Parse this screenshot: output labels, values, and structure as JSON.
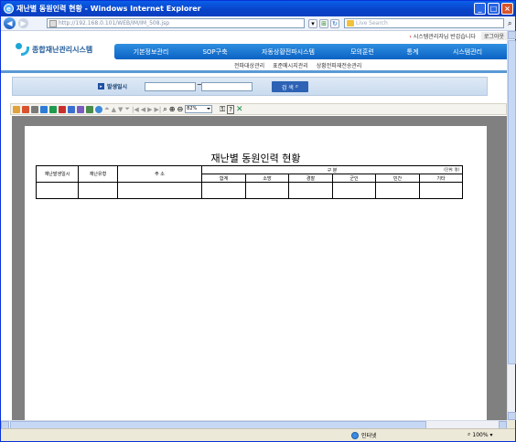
{
  "window": {
    "title": "재난별 동원인력 현황 - Windows Internet Explorer"
  },
  "browser": {
    "address": "http://192.168.0.101/WEB/IM/IM_508.jsp",
    "search_placeholder": "Live Search"
  },
  "site": {
    "top_links": [
      "시스템관리자님 반갑습니다",
      "로그아웃"
    ],
    "logo_text": "종합재난관리시스템",
    "menu": [
      "기본정보관리",
      "SOP구축",
      "자동상황전파시스템",
      "모의훈련",
      "통계",
      "시스템관리"
    ],
    "submenu": [
      "전파대상관리",
      "표준메시지관리",
      "상황전파재전송관리"
    ]
  },
  "filter": {
    "label": "발생일시",
    "from_value": "",
    "to_value": "",
    "separator": "~",
    "search_button": "검 색"
  },
  "report_toolbar": {
    "zoom": "82%"
  },
  "report": {
    "title": "재난별 동원인력 현황",
    "unit": "(단위: 명)",
    "headers": {
      "occurred": "재난발생일시",
      "type": "재난유형",
      "address": "주 소",
      "category": "구 분",
      "sub": [
        "합계",
        "소방",
        "경찰",
        "군인",
        "민간",
        "기타"
      ]
    }
  },
  "status": {
    "zone": "인터넷",
    "zoom": "100%"
  },
  "colors": {
    "menu_blue": "#0b62c4",
    "titlebar": "#0842c8"
  }
}
